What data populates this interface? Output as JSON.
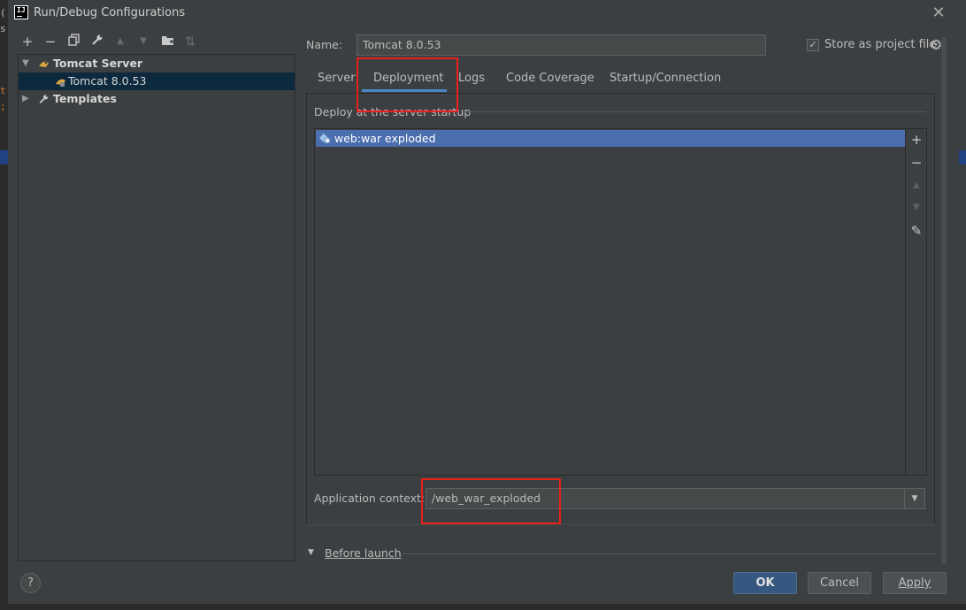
{
  "window": {
    "title": "Run/Debug Configurations",
    "app_icon_text": "IJ",
    "close_glyph": "✕"
  },
  "editor_edge": {
    "chars": [
      "(",
      "s",
      "t",
      ";"
    ]
  },
  "toolbar": {
    "add": "+",
    "remove": "−",
    "copy": "⧉",
    "edit_defaults": "🔧",
    "move_up": "▲",
    "move_down": "▼",
    "folder": "📁",
    "sort": "⇅"
  },
  "tree": {
    "group_label": "Tomcat Server",
    "selected_item": "Tomcat 8.0.53",
    "templates_label": "Templates"
  },
  "config": {
    "name_label": "Name:",
    "name_value": "Tomcat 8.0.53",
    "store_checked": true,
    "store_label": "Store as project file"
  },
  "tabs": [
    {
      "label": "Server"
    },
    {
      "label": "Deployment",
      "active": true
    },
    {
      "label": "Logs"
    },
    {
      "label": "Code Coverage"
    },
    {
      "label": "Startup/Connection"
    }
  ],
  "deployment": {
    "section_title": "Deploy at the server startup",
    "artifacts": [
      {
        "label": "web:war exploded",
        "selected": true
      }
    ],
    "side_buttons": {
      "add": "+",
      "remove": "−",
      "up": "▲",
      "down": "▼",
      "edit": "✎"
    },
    "context_label": "Application context:",
    "context_value": "/web_war_exploded",
    "dropdown_glyph": "▼"
  },
  "before_launch": {
    "label": "Before launch",
    "expanded": true
  },
  "footer": {
    "help": "?",
    "ok": "OK",
    "cancel": "Cancel",
    "apply": "Apply"
  },
  "colors": {
    "background": "#3c3f41",
    "selection": "#4b6eaf",
    "tree_selection": "#0d293e",
    "highlight_box": "#e8201a",
    "tab_underline": "#4a88c7",
    "primary_button": "#365880"
  }
}
